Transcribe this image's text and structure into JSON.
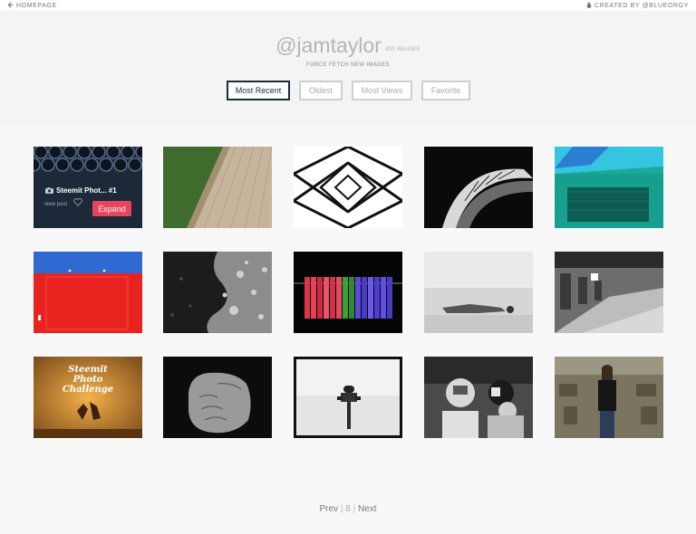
{
  "topbar": {
    "homepage_label": "HOMEPAGE",
    "credit_label": "CREATED BY @BLUEORGY"
  },
  "profile": {
    "username": "@jamtaylor",
    "image_count": "400 IMAGES",
    "force_fetch_label": "FORCE FETCH NEW IMAGES"
  },
  "sort": {
    "options": [
      "Most Recent",
      "Oldest",
      "Most Views",
      "Favorite"
    ],
    "selected": "Most Recent"
  },
  "card_overlay": {
    "title": "Steemit Phot... #1",
    "view_post_label": "view post",
    "expand_label": "Expand"
  },
  "thumb_texts": {
    "poster_line1": "Steemit",
    "poster_line2": "Photo",
    "poster_line3": "Challenge"
  },
  "pagination": {
    "prev_label": "Prev",
    "current_page": "8",
    "next_label": "Next"
  },
  "colors": {
    "active_border": "#1c2a3b",
    "expand_button": "#e8445e"
  }
}
